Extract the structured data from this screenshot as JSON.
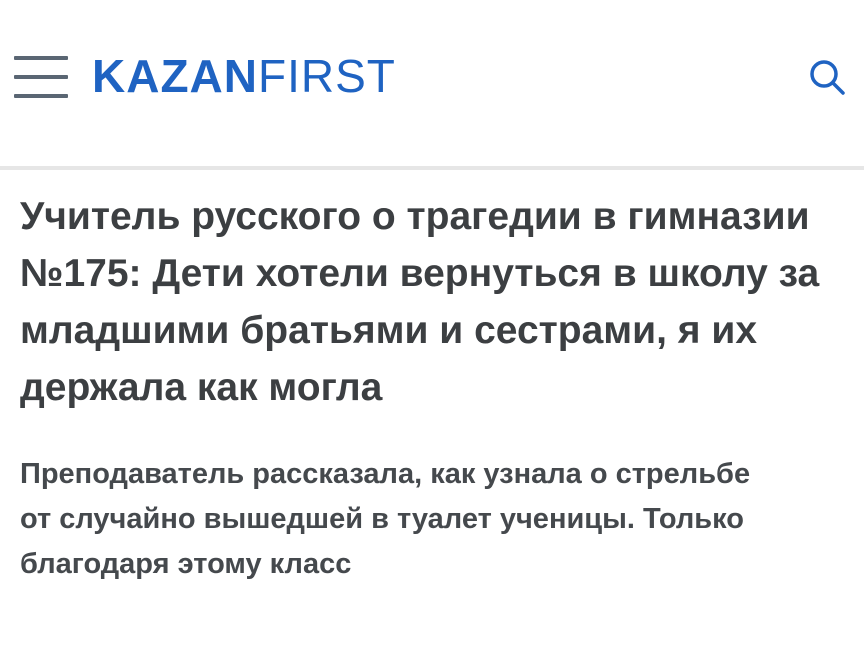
{
  "header": {
    "logo_bold": "KAZAN",
    "logo_light": "FIRST",
    "menu_icon": "hamburger-menu-icon",
    "search_icon": "search-icon",
    "brand_color": "#1f63c2"
  },
  "article": {
    "headline": "Учитель русского о трагедии в гимназии №175: Дети хотели вернуться в школу за младшими братьями и сестрами, я их держала как могла",
    "lead": "Преподаватель рассказала, как узнала о стрельбе от случайно вышедшей в туалет ученицы. Только благодаря этому класс"
  }
}
